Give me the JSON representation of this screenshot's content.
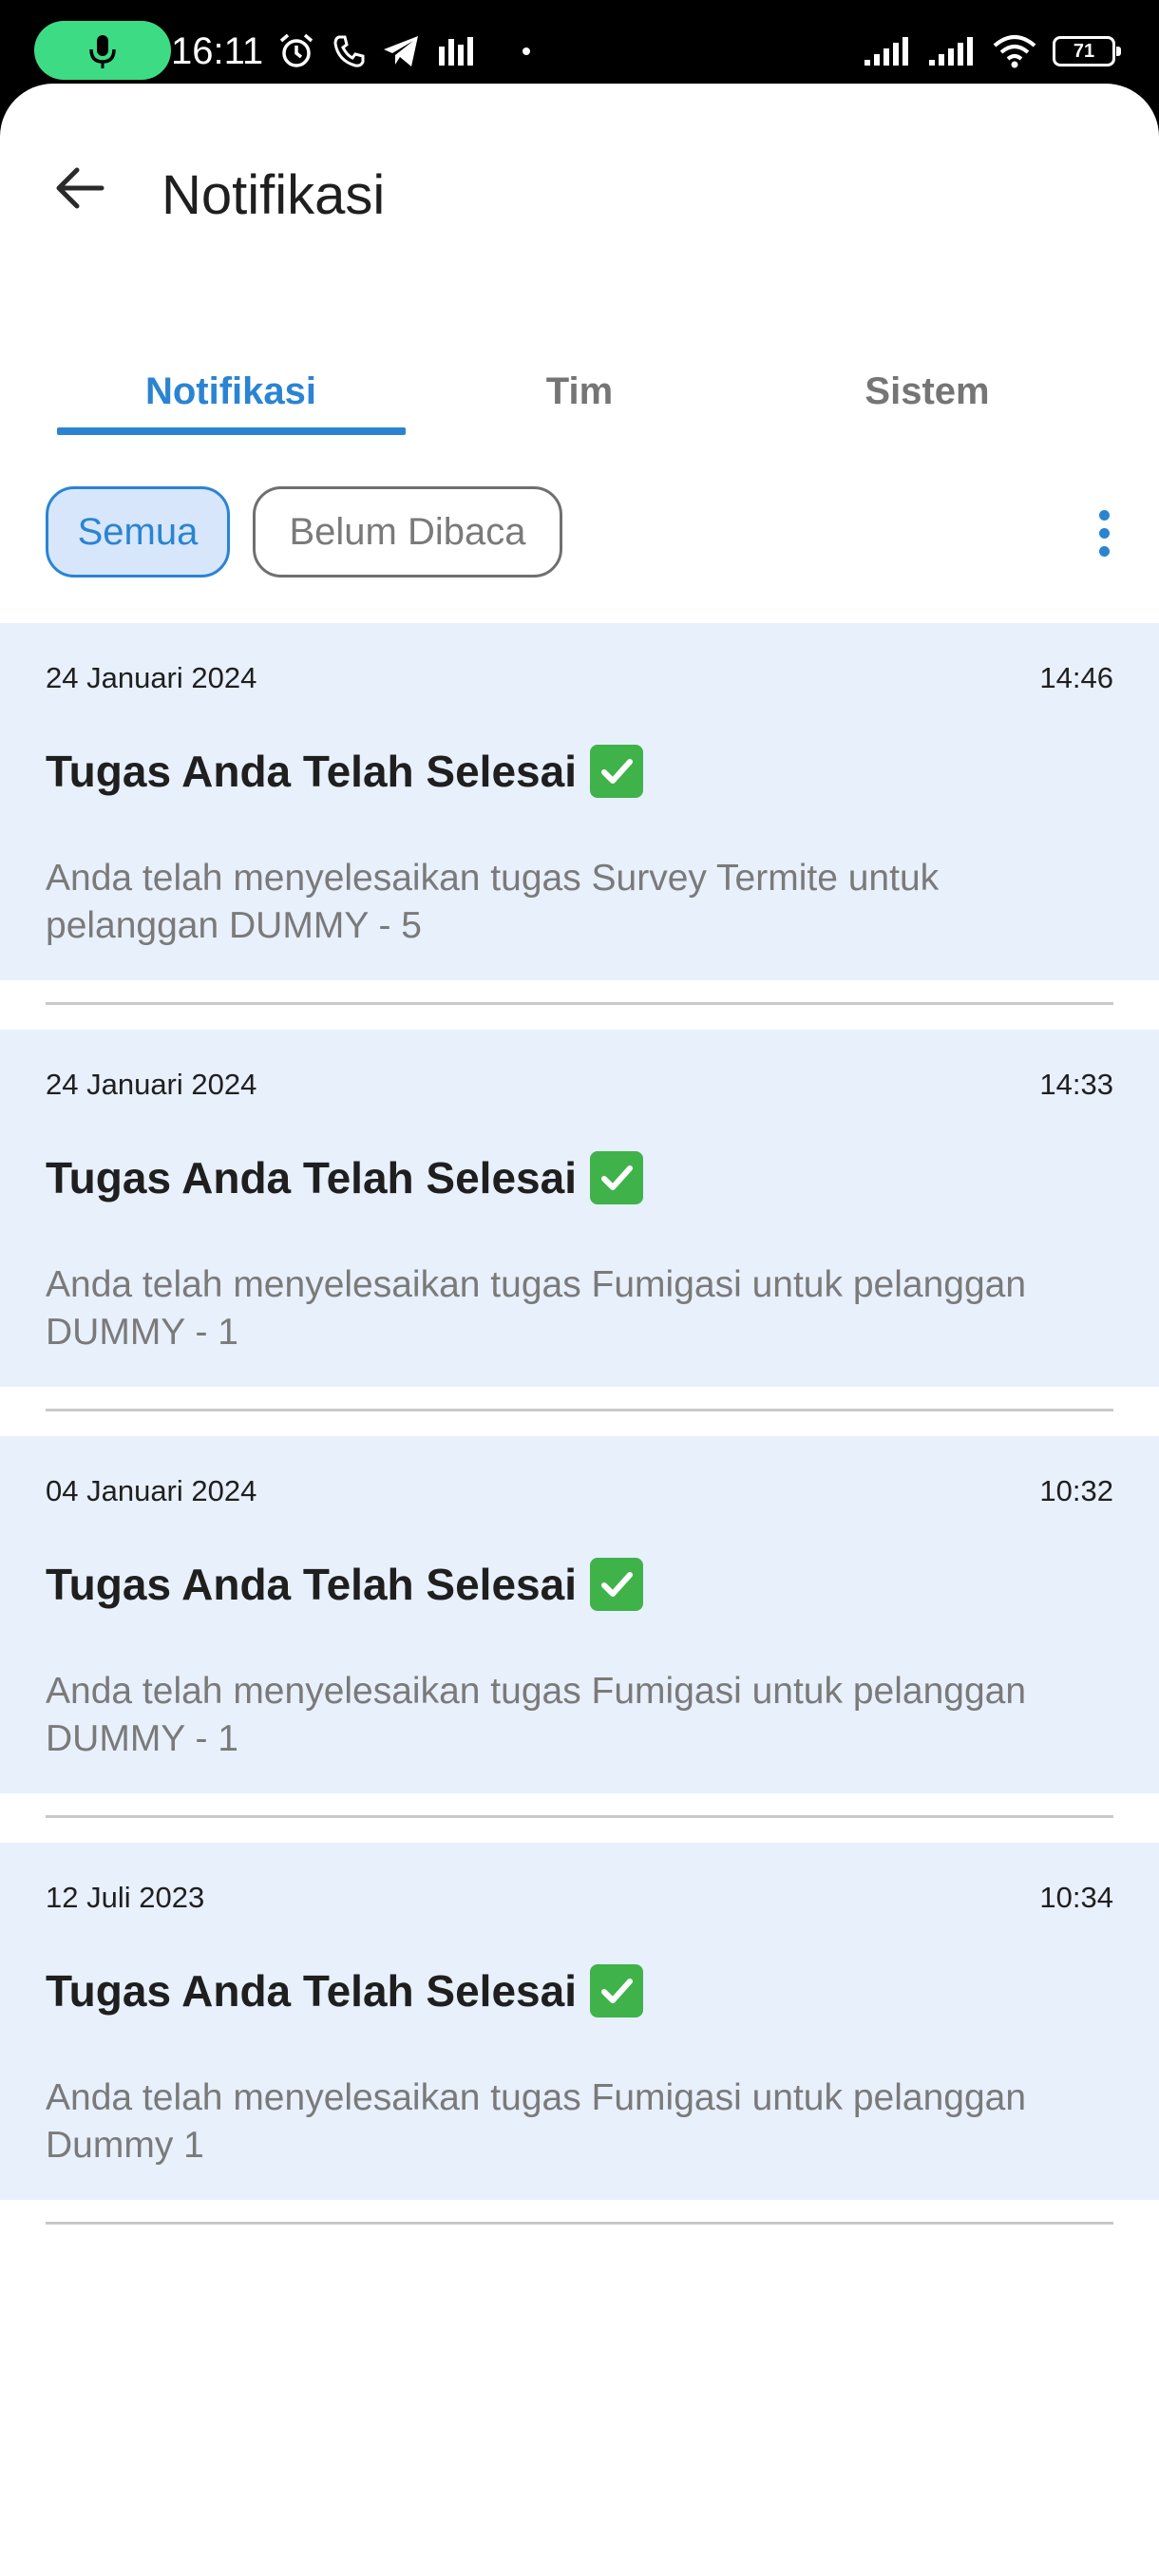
{
  "status_bar": {
    "time": "16:11",
    "battery": "71"
  },
  "header": {
    "title": "Notifikasi"
  },
  "tabs": [
    {
      "label": "Notifikasi",
      "active": true
    },
    {
      "label": "Tim",
      "active": false
    },
    {
      "label": "Sistem",
      "active": false
    }
  ],
  "filters": [
    {
      "label": "Semua",
      "selected": true
    },
    {
      "label": "Belum Dibaca",
      "selected": false
    }
  ],
  "notifications": [
    {
      "date": "24 Januari 2024",
      "time": "14:46",
      "title": "Tugas Anda Telah Selesai",
      "body": "Anda telah menyelesaikan tugas Survey Termite untuk pelanggan DUMMY - 5"
    },
    {
      "date": "24 Januari 2024",
      "time": "14:33",
      "title": "Tugas Anda Telah Selesai",
      "body": "Anda telah menyelesaikan tugas Fumigasi untuk pelanggan DUMMY - 1"
    },
    {
      "date": "04 Januari 2024",
      "time": "10:32",
      "title": "Tugas Anda Telah Selesai",
      "body": "Anda telah menyelesaikan tugas Fumigasi untuk pelanggan DUMMY - 1"
    },
    {
      "date": "12 Juli 2023",
      "time": "10:34",
      "title": "Tugas Anda Telah Selesai",
      "body": "Anda telah menyelesaikan tugas Fumigasi untuk pelanggan Dummy 1"
    }
  ],
  "colors": {
    "accent": "#2a84d2",
    "card_background": "#e8f0fc",
    "check": "#3fb24a",
    "mic_pill": "#3ddc84"
  },
  "icons": [
    "mic-icon",
    "alarm-icon",
    "phone-icon",
    "telegram-icon",
    "signal-icon",
    "wifi-icon",
    "battery-icon",
    "back-arrow-icon",
    "more-vert-icon",
    "check-mark-icon"
  ]
}
